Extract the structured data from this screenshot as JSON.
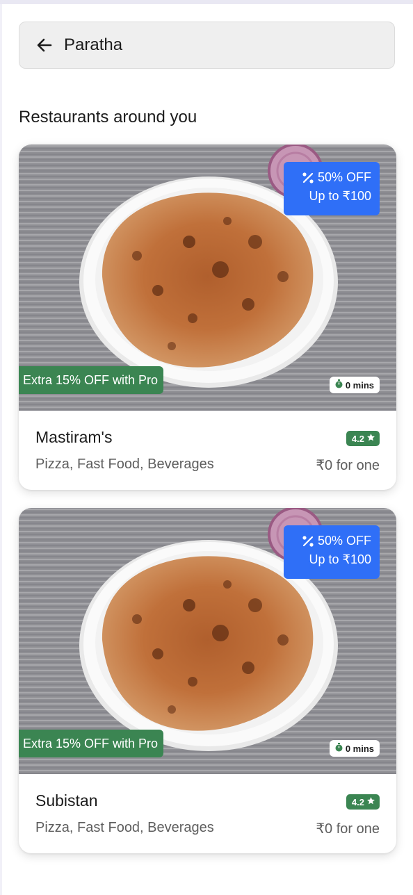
{
  "search": {
    "query": "Paratha",
    "back_icon": "arrow-left-icon"
  },
  "section": {
    "title": "Restaurants around you"
  },
  "colors": {
    "offer_blue": "#2f6ff7",
    "pro_green": "#3b8552",
    "rating_green": "#3b8552",
    "text_primary": "#1c1c1c",
    "text_secondary": "#5e5e5e",
    "search_bg": "#efefef"
  },
  "restaurants": [
    {
      "name": "Mastiram's",
      "cuisines": "Pizza, Fast Food, Beverages",
      "price": "₹0 for one",
      "rating": "4.2",
      "offer_line1": "50% OFF",
      "offer_line2": "Up to ₹100",
      "pro_offer": "Extra 15% OFF with Pro",
      "delivery_time": "0 mins",
      "image": "paratha-on-plate"
    },
    {
      "name": "Subistan",
      "cuisines": "Pizza, Fast Food, Beverages",
      "price": "₹0 for one",
      "rating": "4.2",
      "offer_line1": "50% OFF",
      "offer_line2": "Up to ₹100",
      "pro_offer": "Extra 15% OFF with Pro",
      "delivery_time": "0 mins",
      "image": "paratha-on-plate"
    }
  ]
}
